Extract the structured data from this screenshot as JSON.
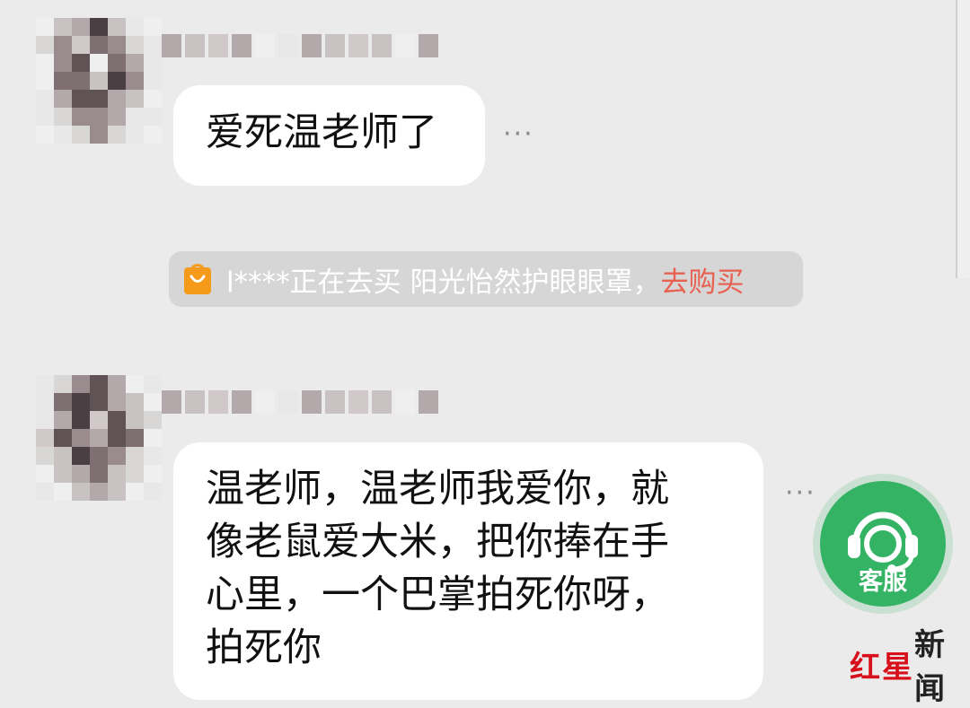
{
  "messages": [
    {
      "text": "爱死温老师了"
    },
    {
      "lines": [
        "温老师，温老师我爱你，就",
        "像老鼠爱大米，把你捧在手",
        "心里，一个巴掌拍死你呀，",
        "拍死你"
      ]
    }
  ],
  "more_icon": "···",
  "notice": {
    "icon": "shopping-bag-icon",
    "text": "l****正在去买 阳光怡然护眼眼罩，",
    "link": "去购买"
  },
  "service": {
    "icon": "headset-icon",
    "label": "客服"
  },
  "watermark": {
    "part1": "红",
    "part2": "星",
    "part3": "新闻"
  },
  "colors": {
    "background": "#ebebeb",
    "bubble": "#ffffff",
    "notice_bg": "#d6d6d6",
    "link": "#e86050",
    "service": "#35b365"
  }
}
